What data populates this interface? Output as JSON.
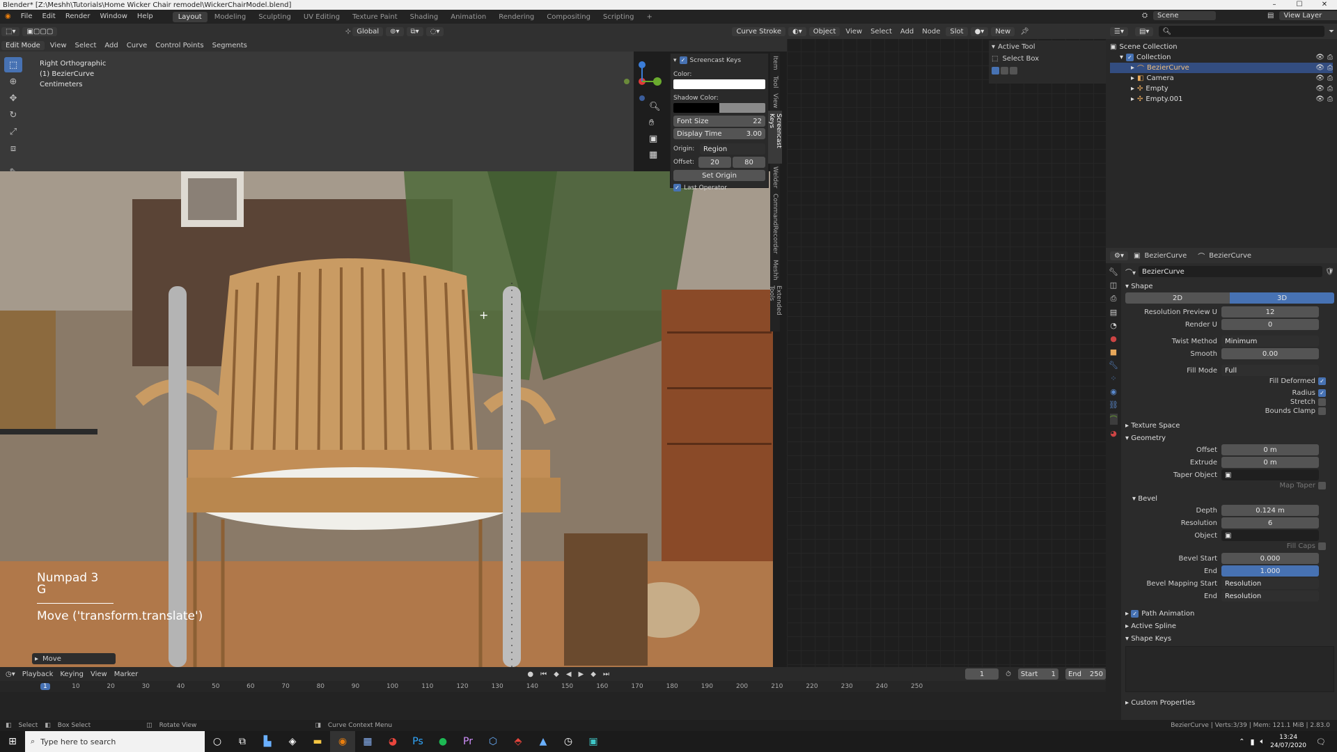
{
  "titlebar": {
    "title": "Blender* [Z:\\Meshh\\Tutorials\\Home Wicker Chair remodel\\WickerChairModel.blend]"
  },
  "menu": [
    "File",
    "Edit",
    "Render",
    "Window",
    "Help"
  ],
  "workspaces": [
    "Layout",
    "Modeling",
    "Sculpting",
    "UV Editing",
    "Texture Paint",
    "Shading",
    "Animation",
    "Rendering",
    "Compositing",
    "Scripting"
  ],
  "viewport": {
    "mode": "Edit Mode",
    "menus": [
      "View",
      "Select",
      "Add",
      "Curve",
      "Control Points",
      "Segments"
    ],
    "transform_orientation": "Global",
    "overlay": {
      "view": "Right Orthographic",
      "object": "(1) BezierCurve",
      "units": "Centimeters"
    },
    "curve_stroke": "Curve Stroke",
    "screencast": {
      "key1": "Numpad 3",
      "key2": "G",
      "operator": "Move ('transform.translate')"
    },
    "last_op_panel": "Move"
  },
  "screencast_panel": {
    "title": "Screencast Keys",
    "color_label": "Color:",
    "shadow_label": "Shadow Color:",
    "font_size_label": "Font Size",
    "font_size": "22",
    "display_time_label": "Display Time",
    "display_time": "3.00",
    "origin_label": "Origin:",
    "origin": "Region",
    "offset_label": "Offset:",
    "offset_x": "20",
    "offset_y": "80",
    "set_origin": "Set Origin",
    "last_operator": "Last Operator"
  },
  "side_tabs": [
    "Item",
    "Tool",
    "View",
    "Screencast Keys",
    "Welder",
    "CommandRecorder",
    "Meshh",
    "Extended Tools"
  ],
  "node_editor": {
    "object": "Object",
    "menus": [
      "View",
      "Select",
      "Add",
      "Node"
    ],
    "slot": "Slot",
    "new": "New",
    "active_tool_title": "Active Tool",
    "active_tool": "Select Box"
  },
  "outliner": {
    "scene": "Scene",
    "view_layer": "View Layer",
    "items": [
      {
        "name": "Scene Collection",
        "indent": 0
      },
      {
        "name": "Collection",
        "indent": 1
      },
      {
        "name": "BezierCurve",
        "indent": 2,
        "selected": true
      },
      {
        "name": "Camera",
        "indent": 2
      },
      {
        "name": "Empty",
        "indent": 2
      },
      {
        "name": "Empty.001",
        "indent": 2
      }
    ]
  },
  "properties": {
    "object_name": "BezierCurve",
    "data_name": "BezierCurve",
    "datablock": "BezierCurve",
    "shape_section": "Shape",
    "dim_2d": "2D",
    "dim_3d": "3D",
    "resolution_preview_u_label": "Resolution Preview U",
    "resolution_preview_u": "12",
    "render_u_label": "Render U",
    "render_u": "0",
    "twist_method_label": "Twist Method",
    "twist_method": "Minimum",
    "smooth_label": "Smooth",
    "smooth": "0.00",
    "fill_mode_label": "Fill Mode",
    "fill_mode": "Full",
    "fill_deformed_label": "Fill Deformed",
    "radius_label": "Radius",
    "stretch_label": "Stretch",
    "bounds_clamp_label": "Bounds Clamp",
    "texture_space": "Texture Space",
    "geometry": "Geometry",
    "offset_label": "Offset",
    "offset": "0 m",
    "extrude_label": "Extrude",
    "extrude": "0 m",
    "taper_label": "Taper Object",
    "map_taper": "Map Taper",
    "bevel": "Bevel",
    "depth_label": "Depth",
    "depth": "0.124 m",
    "resolution_label": "Resolution",
    "resolution": "6",
    "object_label": "Object",
    "fill_caps": "Fill Caps",
    "bevel_start_label": "Bevel Start",
    "bevel_start": "0.000",
    "end_label": "End",
    "bevel_end": "1.000",
    "bevel_mapping_start_label": "Bevel Mapping Start",
    "bevel_mapping_start": "Resolution",
    "mapping_end_label": "End",
    "bevel_mapping_end": "Resolution",
    "path_animation": "Path Animation",
    "active_spline": "Active Spline",
    "shape_keys": "Shape Keys",
    "custom_properties": "Custom Properties"
  },
  "timeline": {
    "menus": [
      "Playback",
      "Keying",
      "View",
      "Marker"
    ],
    "current_frame": "1",
    "start_label": "Start",
    "start": "1",
    "end_label": "End",
    "end": "250",
    "ticks": [
      "1",
      "10",
      "20",
      "30",
      "40",
      "50",
      "60",
      "70",
      "80",
      "90",
      "100",
      "110",
      "120",
      "130",
      "140",
      "150",
      "160",
      "170",
      "180",
      "190",
      "200",
      "210",
      "220",
      "230",
      "240",
      "250"
    ]
  },
  "statusbar": {
    "select": "Select",
    "box_select": "Box Select",
    "rotate_view": "Rotate View",
    "context_menu": "Curve Context Menu",
    "stats": "BezierCurve | Verts:3/39 | Mem: 121.1 MiB | 2.83.0"
  },
  "taskbar": {
    "search_placeholder": "Type here to search",
    "time": "13:24",
    "date": "24/07/2020"
  }
}
